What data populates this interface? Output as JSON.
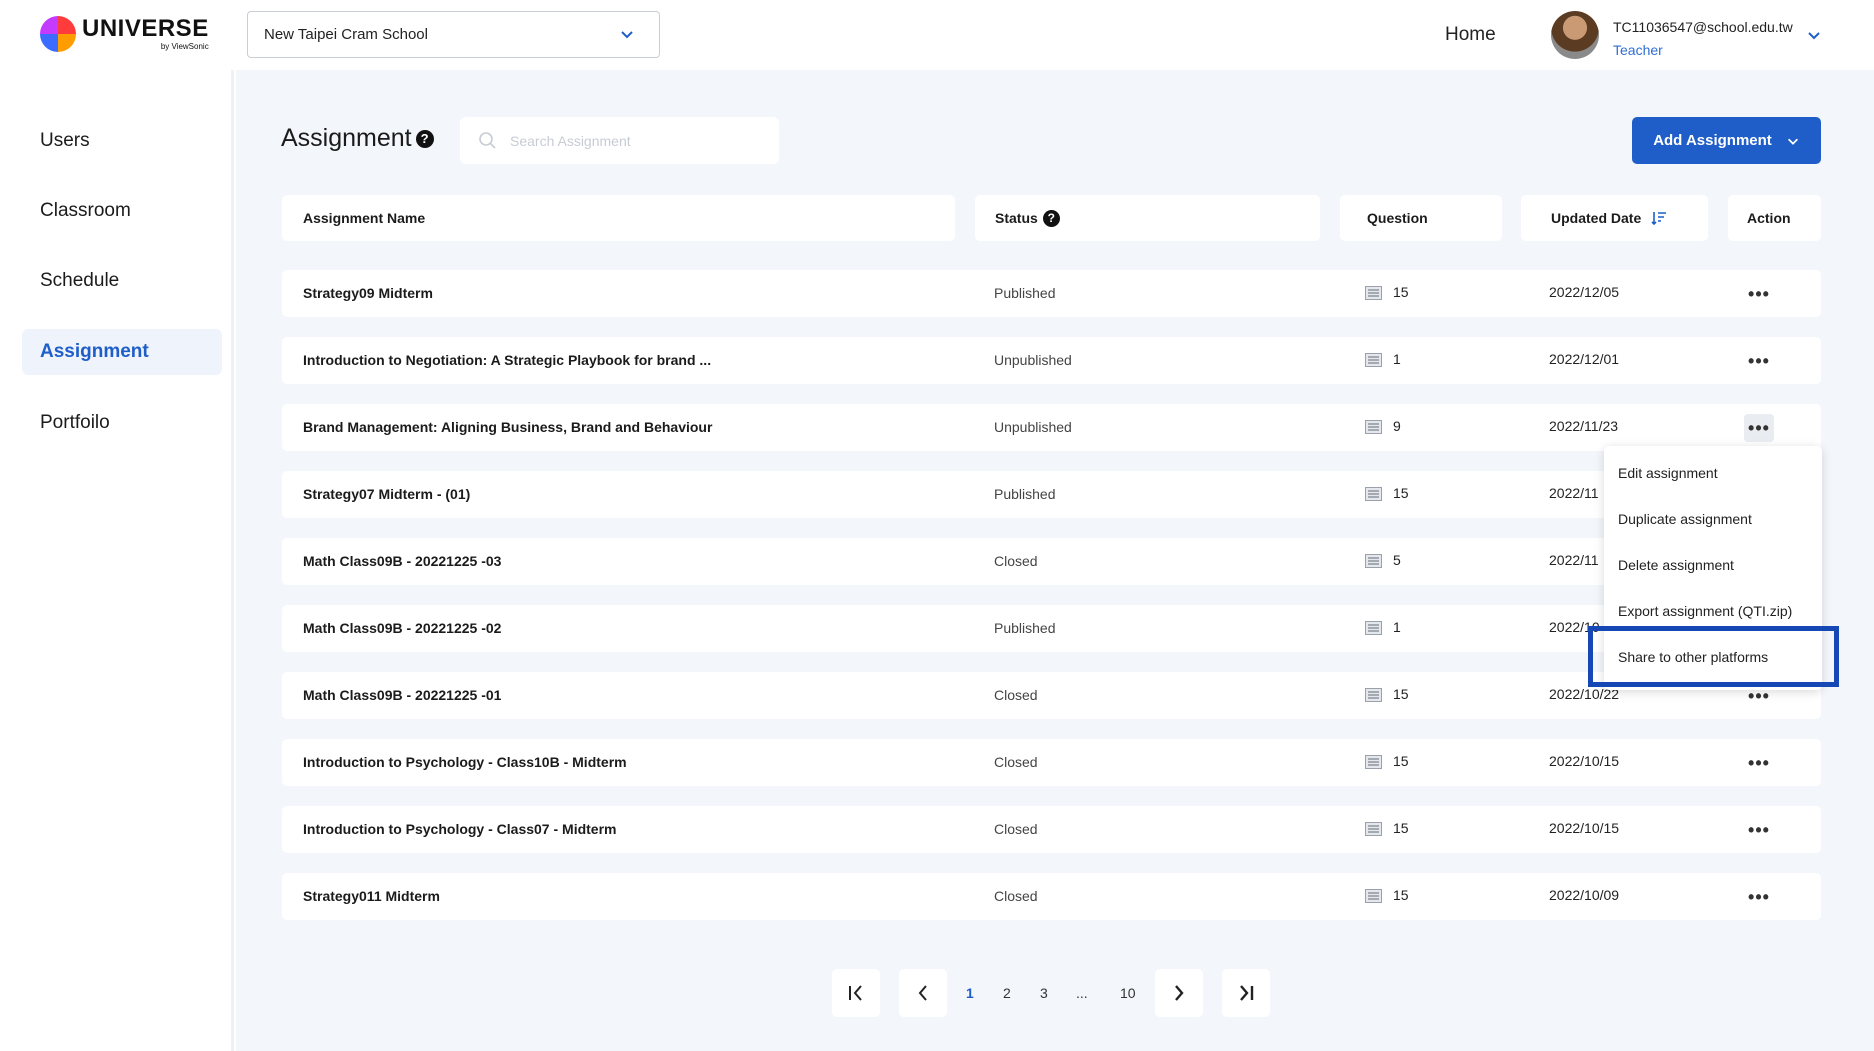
{
  "brand": {
    "name": "UNIVERSE",
    "sub": "by ViewSonic"
  },
  "header": {
    "school": "New Taipei Cram School",
    "home_label": "Home",
    "user_email": "TC11036547@school.edu.tw",
    "user_role": "Teacher"
  },
  "sidebar": {
    "items": [
      {
        "label": "Users"
      },
      {
        "label": "Classroom"
      },
      {
        "label": "Schedule"
      },
      {
        "label": "Assignment",
        "active": true
      },
      {
        "label": "Portfoilo"
      }
    ]
  },
  "page": {
    "title": "Assignment",
    "search_placeholder": "Search Assignment",
    "add_button": "Add Assignment"
  },
  "table": {
    "headers": {
      "name": "Assignment Name",
      "status": "Status",
      "question": "Question",
      "updated": "Updated Date",
      "action": "Action"
    },
    "rows": [
      {
        "name": "Strategy09 Midterm",
        "status": "Published",
        "questions": "15",
        "date": "2022/12/05"
      },
      {
        "name": "Introduction to Negotiation: A Strategic Playbook for brand ...",
        "status": "Unpublished",
        "questions": "1",
        "date": "2022/12/01"
      },
      {
        "name": "Brand Management: Aligning Business, Brand and Behaviour",
        "status": "Unpublished",
        "questions": "9",
        "date": "2022/11/23"
      },
      {
        "name": "Strategy07 Midterm - (01)",
        "status": "Published",
        "questions": "15",
        "date": "2022/11"
      },
      {
        "name": "Math Class09B - 20221225 -03",
        "status": "Closed",
        "questions": "5",
        "date": "2022/11"
      },
      {
        "name": "Math Class09B - 20221225 -02",
        "status": "Published",
        "questions": "1",
        "date": "2022/10"
      },
      {
        "name": "Math Class09B - 20221225 -01",
        "status": "Closed",
        "questions": "15",
        "date": "2022/10/22"
      },
      {
        "name": "Introduction to Psychology - Class10B - Midterm",
        "status": "Closed",
        "questions": "15",
        "date": "2022/10/15"
      },
      {
        "name": "Introduction to Psychology - Class07 - Midterm",
        "status": "Closed",
        "questions": "15",
        "date": "2022/10/15"
      },
      {
        "name": "Strategy011 Midterm",
        "status": "Closed",
        "questions": "15",
        "date": "2022/10/09"
      }
    ]
  },
  "action_menu": {
    "items": [
      "Edit assignment",
      "Duplicate assignment",
      "Delete assignment",
      "Export assignment (QTI.zip)",
      "Share to other platforms"
    ],
    "highlighted": "Share to other platforms"
  },
  "pagination": {
    "pages": [
      "1",
      "2",
      "3",
      "...",
      "10"
    ],
    "current": "1"
  },
  "colors": {
    "accent": "#1f5ec9",
    "highlight_border": "#1547b5",
    "background": "#f3f6fb"
  }
}
